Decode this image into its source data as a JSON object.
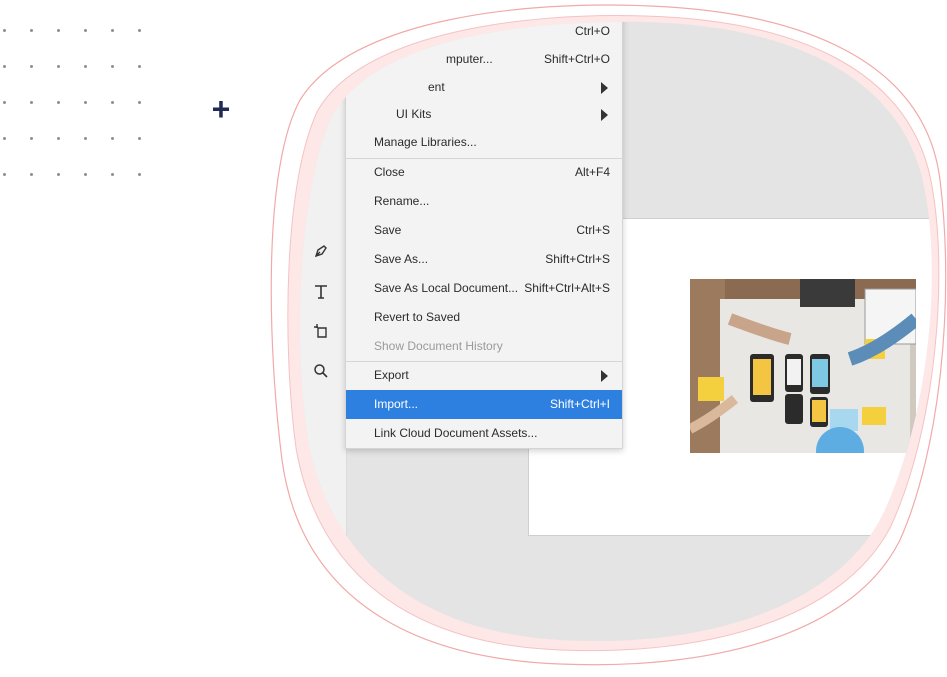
{
  "decor": {
    "plus_symbol": "+",
    "accent_color": "#1f2a55",
    "blob_stroke_color": "#f1a9a9"
  },
  "toolbar": {
    "tools": [
      {
        "name": "pen-icon"
      },
      {
        "name": "text-icon"
      },
      {
        "name": "artboard-icon"
      },
      {
        "name": "zoom-icon"
      }
    ]
  },
  "menu": {
    "highlight_color": "#2d7fe0",
    "items": [
      {
        "label": "",
        "shortcut": "Ctrl+O"
      },
      {
        "label": "mputer...",
        "shortcut": "Shift+Ctrl+O"
      },
      {
        "label": "ent",
        "shortcut": "",
        "submenu": true
      },
      {
        "label": "UI Kits",
        "shortcut": "",
        "submenu": true
      },
      {
        "label": "Manage Libraries...",
        "shortcut": ""
      },
      {
        "label": "Close",
        "shortcut": "Alt+F4"
      },
      {
        "label": "Rename...",
        "shortcut": ""
      },
      {
        "label": "Save",
        "shortcut": "Ctrl+S"
      },
      {
        "label": "Save As...",
        "shortcut": "Shift+Ctrl+S"
      },
      {
        "label": "Save As Local Document...",
        "shortcut": "Shift+Ctrl+Alt+S"
      },
      {
        "label": "Revert to Saved",
        "shortcut": ""
      },
      {
        "label": "Show Document History",
        "shortcut": "",
        "disabled": true
      },
      {
        "label": "Export",
        "shortcut": "",
        "submenu": true
      },
      {
        "label": "Import...",
        "shortcut": "Shift+Ctrl+I",
        "highlighted": true
      },
      {
        "label": "Link Cloud Document Assets...",
        "shortcut": ""
      }
    ]
  },
  "canvas": {
    "image_subject": "team sketching mobile app UI wireframes on paper"
  }
}
